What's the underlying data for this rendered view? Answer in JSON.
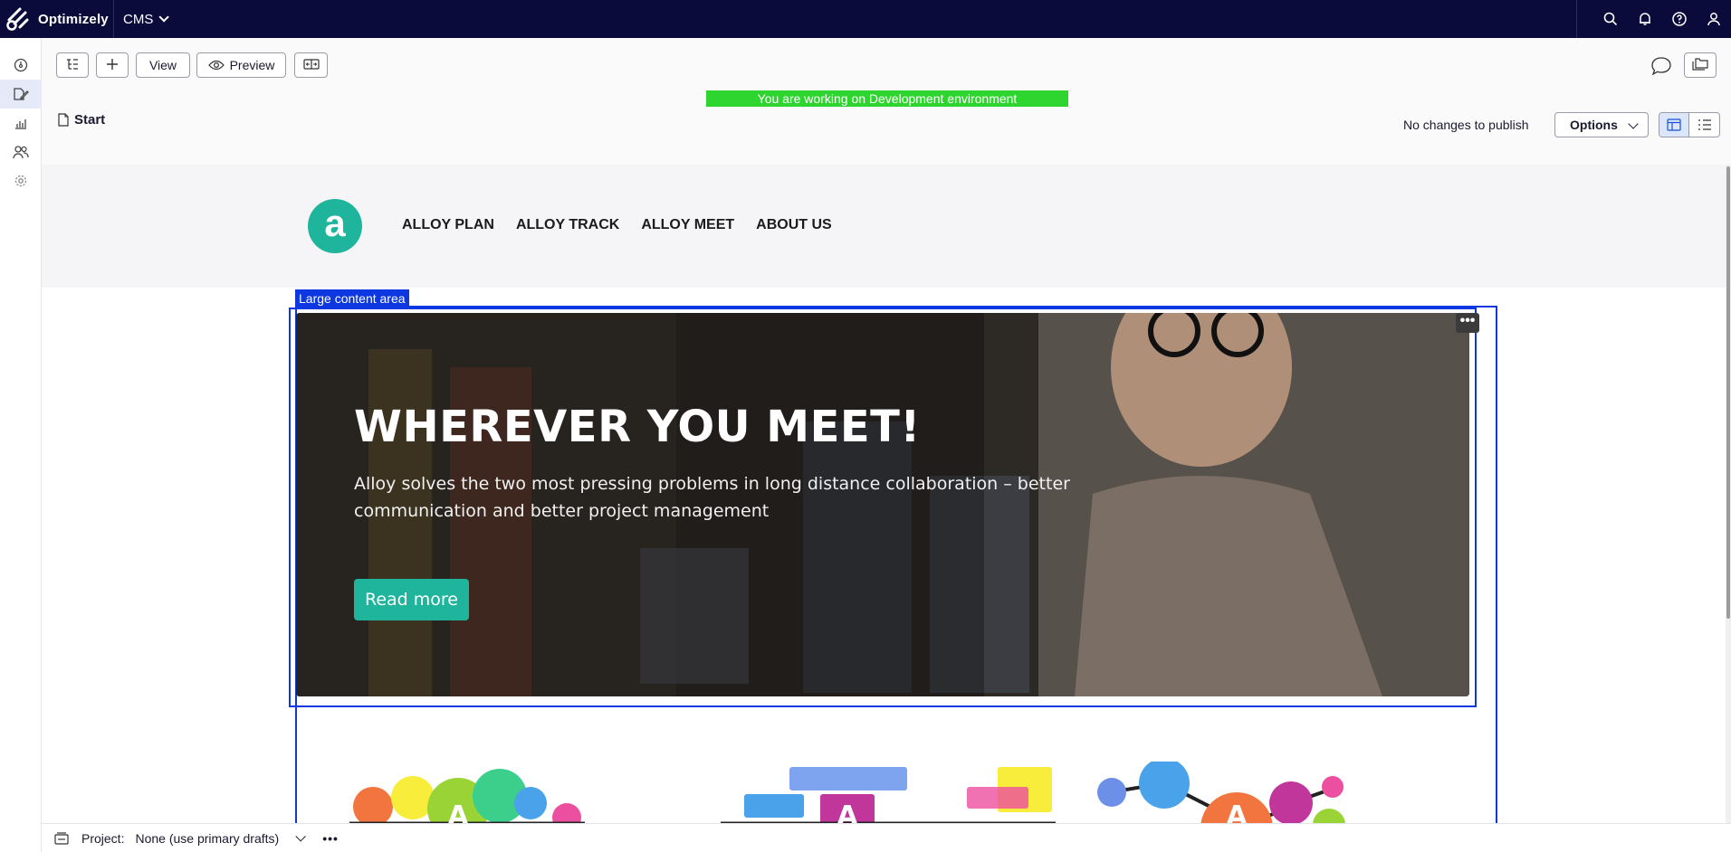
{
  "topbar": {
    "brand_name": "Optimizely",
    "app_name": "CMS",
    "icons": [
      "search-icon",
      "bell-icon",
      "help-icon",
      "user-icon"
    ]
  },
  "rail": {
    "items": [
      "dashboard-icon",
      "edit-icon",
      "analytics-icon",
      "users-icon",
      "settings-icon"
    ],
    "active_index": 1
  },
  "toolbar": {
    "view_label": "View",
    "preview_label": "Preview",
    "environment_banner": "You are working on Development environment",
    "page_name": "Start",
    "publish_status": "No changes to publish",
    "options_label": "Options"
  },
  "site": {
    "logo_letter": "a",
    "nav": [
      "ALLOY PLAN",
      "ALLOY TRACK",
      "ALLOY MEET",
      "ABOUT US"
    ],
    "content_area_label": "Large content area",
    "block_menu": "•••",
    "hero": {
      "title": "WHEREVER YOU MEET!",
      "text": "Alloy solves the two most pressing problems in long distance collaboration – better communication and better project management",
      "cta": "Read more"
    }
  },
  "projectbar": {
    "label": "Project:",
    "value": "None (use primary drafts)",
    "more": "•••"
  },
  "colors": {
    "topbar": "#0b0b3b",
    "environment_banner": "#2fd52f",
    "selection_blue": "#0d37e0",
    "alloy_green": "#1fb59c"
  }
}
